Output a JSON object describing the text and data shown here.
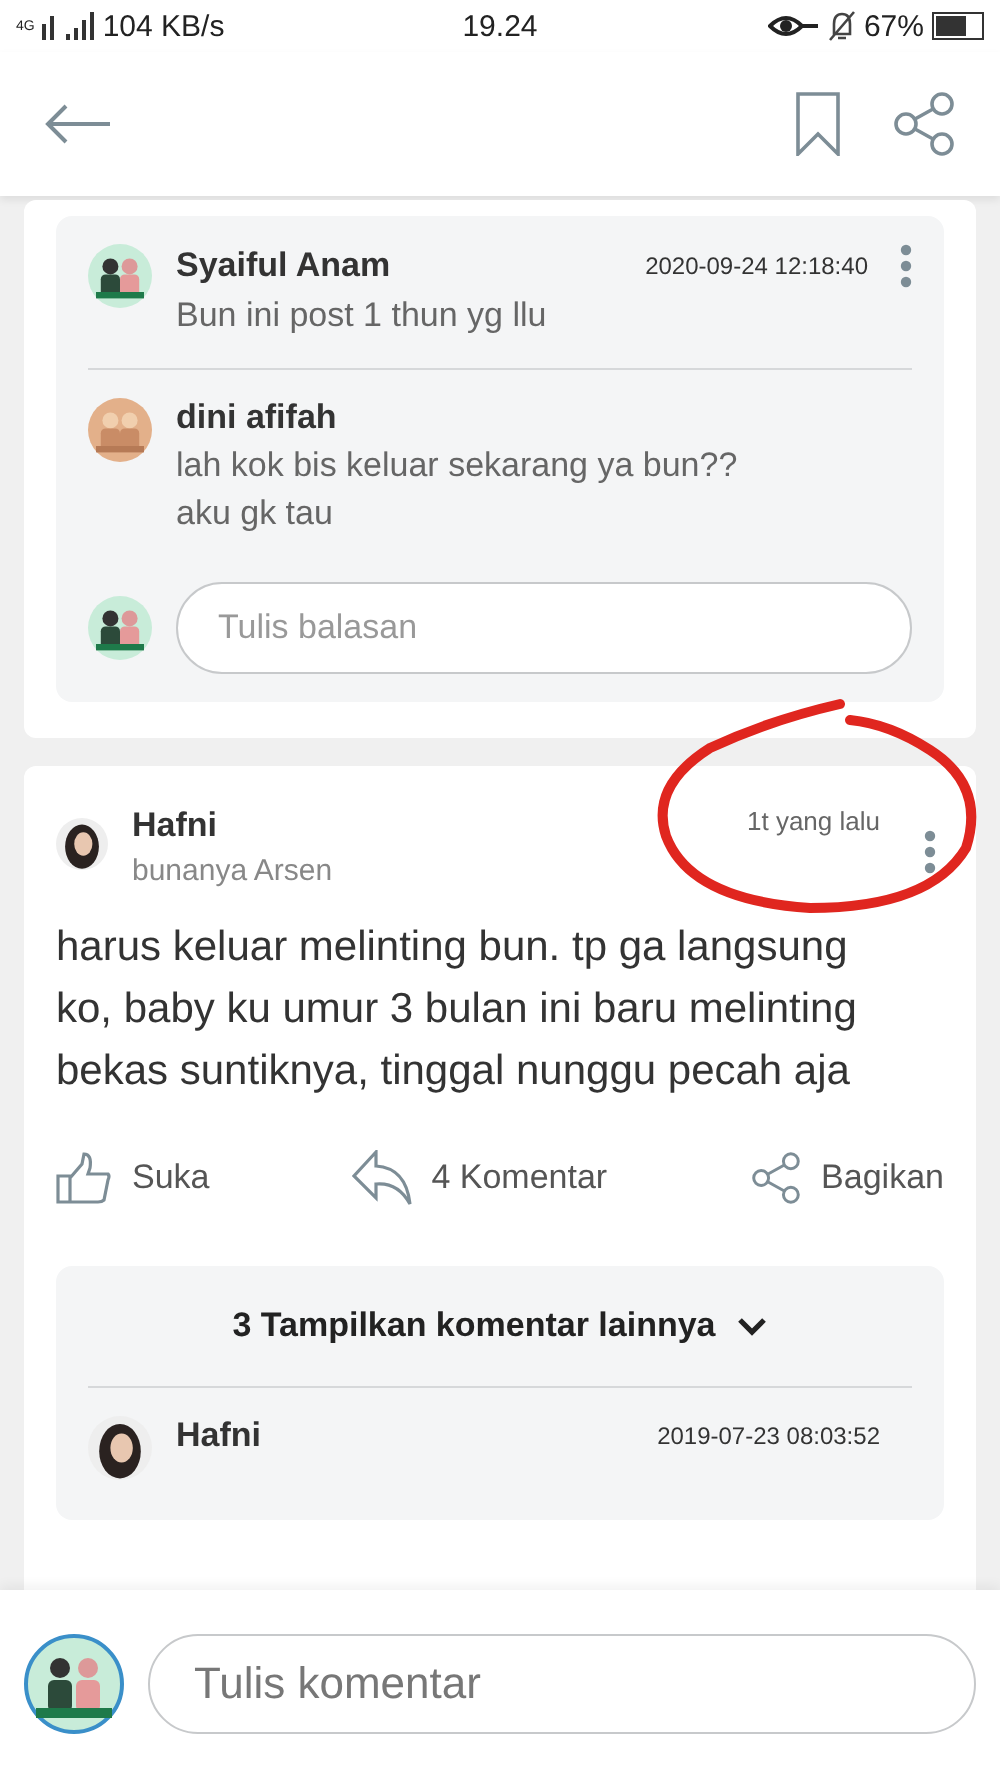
{
  "status_bar": {
    "network_type": "4G",
    "speed": "104 KB/s",
    "time": "19.24",
    "battery": "67%"
  },
  "thread": {
    "comments": [
      {
        "author": "Syaiful Anam",
        "time": "2020-09-24 12:18:40",
        "text": "Bun ini post 1 thun yg llu",
        "has_menu": true
      },
      {
        "author": "dini afifah",
        "text": "lah kok bis keluar sekarang ya bun??\naku gk tau",
        "has_menu": false
      }
    ],
    "reply_placeholder": "Tulis balasan"
  },
  "post": {
    "author": "Hafni",
    "subtitle": "bunanya Arsen",
    "time": "1t yang lalu",
    "text": "harus keluar melinting bun. tp ga langsung ko, baby ku umur 3 bulan ini baru melinting bekas suntiknya, tinggal nunggu pecah aja",
    "actions": [
      {
        "kind": "like",
        "label": "Suka"
      },
      {
        "kind": "comment",
        "label": "4 Komentar"
      },
      {
        "kind": "share",
        "label": "Bagikan"
      }
    ],
    "more_comments": "3 Tampilkan komentar lainnya",
    "comments": [
      {
        "author": "Hafni",
        "time": "2019-07-23 08:03:52"
      }
    ]
  },
  "comment_bar": {
    "placeholder": "Tulis komentar"
  }
}
